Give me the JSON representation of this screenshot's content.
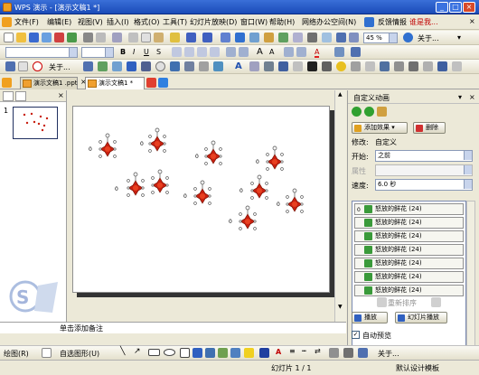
{
  "window": {
    "app": "WPS 演示",
    "doc": "[演示文稿1 *]",
    "title": "WPS 演示 - [演示文稿1 *]"
  },
  "menu": {
    "items": [
      "文件(F)",
      "编辑(E)",
      "视图(V)",
      "插入(I)",
      "格式(O)",
      "工具(T)",
      "幻灯片放映(D)",
      "窗口(W)",
      "帮助(H)",
      "网络办公空间(N)"
    ],
    "feedback": "反馈情报",
    "right_label": "谁是我..."
  },
  "toolbar1": {
    "zoom": "45 %",
    "more": "关于..."
  },
  "toolbar2": {
    "more": "关于..."
  },
  "tabs": {
    "items": [
      "演示文稿1 .ppt",
      "演示文稿1 *"
    ]
  },
  "leftpane": {
    "slide_number": "1"
  },
  "notes": {
    "placeholder": "单击添加备注"
  },
  "panel": {
    "title": "自定义动画",
    "add_effect": "添加效果",
    "delete": "删除",
    "modify_label": "修改:",
    "modify_value": "自定义",
    "start_label": "开始:",
    "start_value": "之前",
    "property_label": "属性",
    "speed_label": "速度:",
    "speed_value": "6.0 秒",
    "reorder": "重新排序",
    "play": "播放",
    "slideshow": "幻灯片播放",
    "autopreview": "自动预览",
    "autopreview_checked": true,
    "list_items": [
      {
        "num": "0",
        "label": "怒放的鲜花  (24)"
      },
      {
        "num": "",
        "label": "怒放的鲜花  (24)"
      },
      {
        "num": "",
        "label": "怒放的鲜花  (24)"
      },
      {
        "num": "",
        "label": "怒放的鲜花  (24)"
      },
      {
        "num": "",
        "label": "怒放的鲜花  (24)"
      },
      {
        "num": "",
        "label": "怒放的鲜花  (24)"
      },
      {
        "num": "",
        "label": "怒放的鲜花  (24)"
      }
    ]
  },
  "drawbar": {
    "draw": "绘图(R)",
    "autoshape": "自选图形(U)",
    "more": "关于..."
  },
  "status": {
    "slide": "幻灯片 1 / 1",
    "template": "默认设计模板"
  },
  "colors": {
    "accent": "#1a4bb8",
    "flower": "#c82010"
  }
}
